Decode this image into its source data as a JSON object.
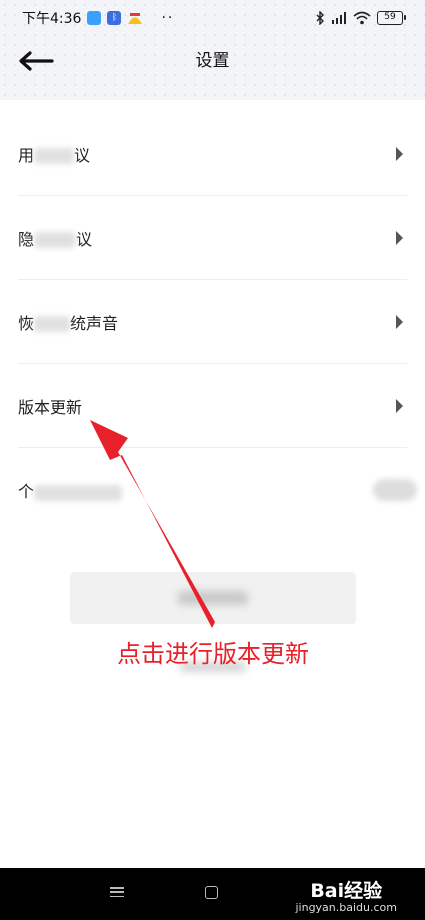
{
  "status_bar": {
    "time": "下午4:36",
    "dots": "··",
    "battery": "59",
    "icons": [
      "message-icon",
      "bluetooth-app-icon",
      "app-icon",
      "bluetooth-icon",
      "hd-signal-icon",
      "wifi-icon",
      "battery-icon"
    ]
  },
  "header": {
    "title": "设置",
    "back_icon": "back-arrow-icon"
  },
  "settings": {
    "items": [
      {
        "label_start": "用",
        "label_end": "议"
      },
      {
        "label_start": "隐",
        "label_end": "议"
      },
      {
        "label_start": "恢",
        "label_end": "统声音"
      },
      {
        "label": "版本更新"
      },
      {
        "label_start": "个"
      }
    ]
  },
  "annotation": {
    "text": "点击进行版本更新",
    "color": "#e8202a"
  },
  "watermark": {
    "main": "Bai经验",
    "sub": "jingyan.baidu.com"
  },
  "colors": {
    "accent_annotation": "#e8202a",
    "header_bg": "#f3f4f7",
    "nav_bar": "#000000"
  }
}
